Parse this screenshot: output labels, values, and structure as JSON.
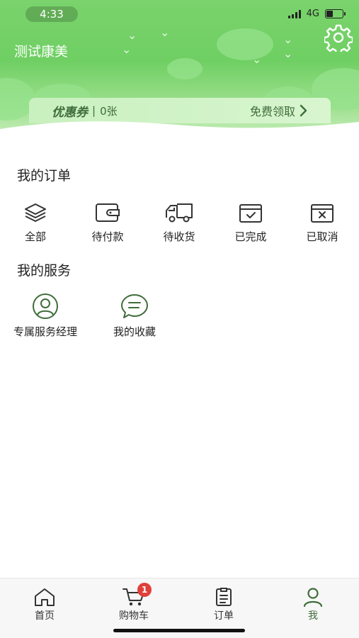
{
  "status_bar": {
    "time": "4:33",
    "network": "4G"
  },
  "profile": {
    "name": "测试康美"
  },
  "coupon": {
    "title": "优惠券",
    "separator": "|",
    "count": "0张",
    "action": "免费领取"
  },
  "orders": {
    "title": "我的订单",
    "items": [
      {
        "label": "全部",
        "icon": "layers-icon"
      },
      {
        "label": "待付款",
        "icon": "wallet-icon"
      },
      {
        "label": "待收货",
        "icon": "truck-icon"
      },
      {
        "label": "已完成",
        "icon": "calendar-check-icon"
      },
      {
        "label": "已取消",
        "icon": "calendar-cancel-icon"
      }
    ]
  },
  "services": {
    "title": "我的服务",
    "items": [
      {
        "label": "专属服务经理",
        "icon": "person-circle-icon"
      },
      {
        "label": "我的收藏",
        "icon": "chat-bubble-icon"
      }
    ]
  },
  "tabbar": {
    "items": [
      {
        "label": "首页",
        "icon": "home-icon"
      },
      {
        "label": "购物车",
        "icon": "cart-icon",
        "badge": "1"
      },
      {
        "label": "订单",
        "icon": "clipboard-icon"
      },
      {
        "label": "我",
        "icon": "user-icon",
        "active": true
      }
    ]
  },
  "colors": {
    "accent": "#3f6d3a",
    "header_green": "#6fcf63",
    "badge_red": "#e0413a"
  }
}
